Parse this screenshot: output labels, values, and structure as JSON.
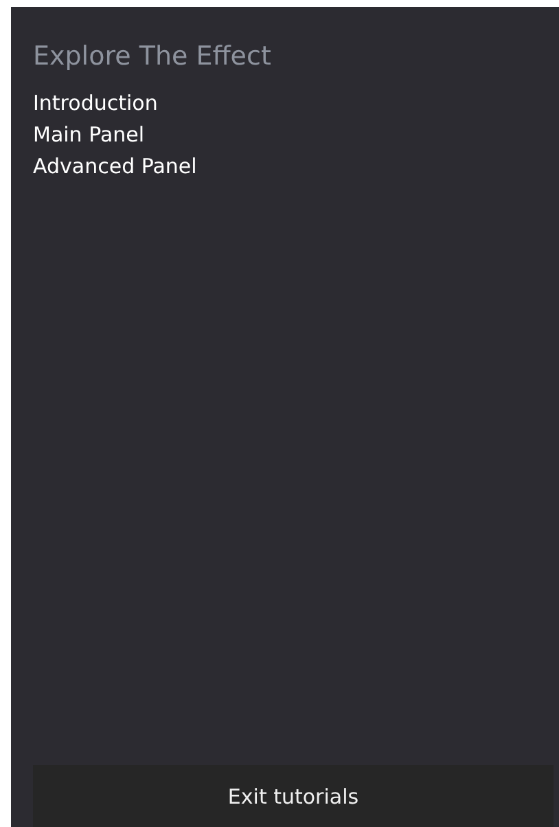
{
  "title": "Explore The Effect",
  "items": [
    "Introduction",
    "Main Panel",
    "Advanced Panel"
  ],
  "button": "Exit tutorials"
}
